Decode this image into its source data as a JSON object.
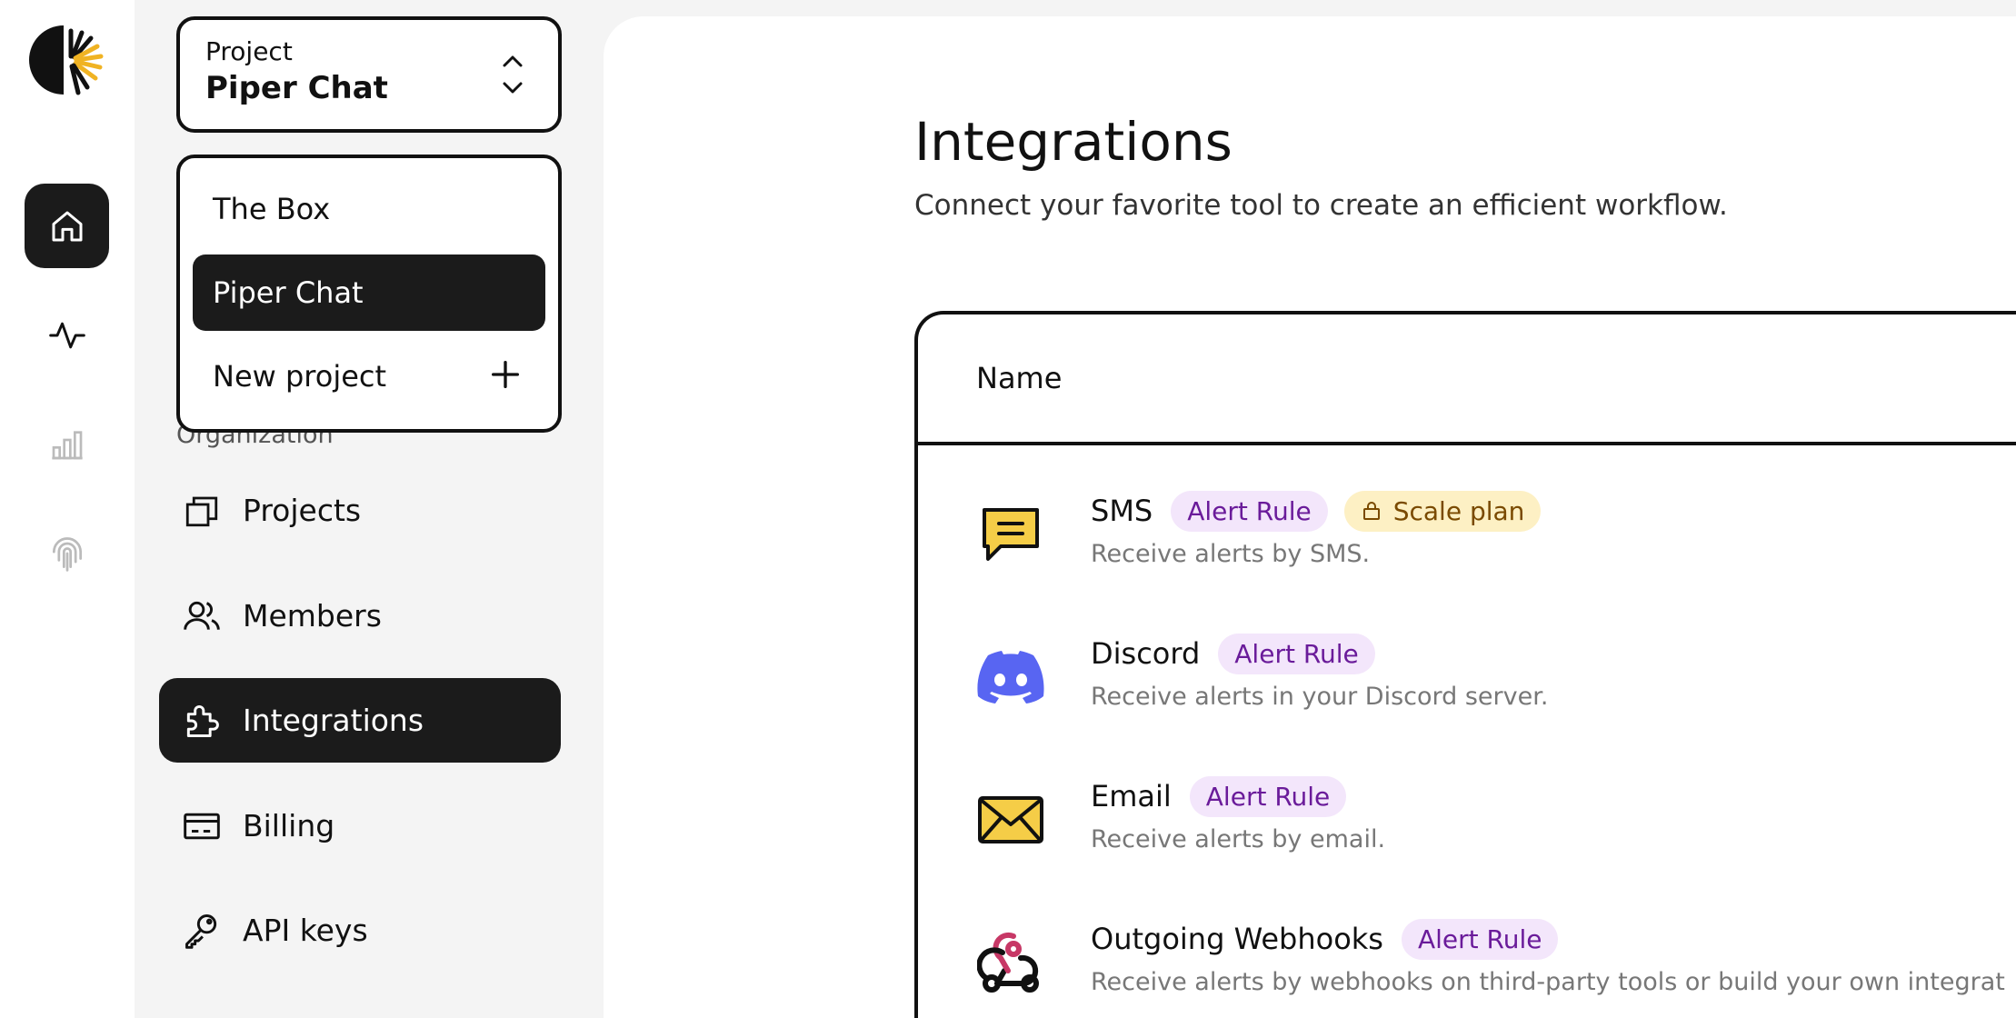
{
  "rail": {
    "icons": [
      "home-icon",
      "activity-icon",
      "bar-chart-icon",
      "fingerprint-icon"
    ]
  },
  "project": {
    "caption": "Project",
    "current": "Piper Chat"
  },
  "dropdown": {
    "items": [
      "The Box",
      "Piper Chat"
    ],
    "new_project": "New project"
  },
  "organization": {
    "label": "Organization",
    "items": [
      {
        "label": "Projects",
        "icon": "projects-icon"
      },
      {
        "label": "Members",
        "icon": "members-icon"
      },
      {
        "label": "Integrations",
        "icon": "puzzle-icon"
      },
      {
        "label": "Billing",
        "icon": "billing-icon"
      },
      {
        "label": "API keys",
        "icon": "key-icon"
      }
    ]
  },
  "main": {
    "title": "Integrations",
    "subtitle": "Connect your favorite tool to create an efficient workflow.",
    "table": {
      "header": "Name",
      "rows": [
        {
          "name": "SMS",
          "badge": "Alert Rule",
          "plan": "Scale plan",
          "desc": "Receive alerts by SMS.",
          "icon": "sms-icon"
        },
        {
          "name": "Discord",
          "badge": "Alert Rule",
          "desc": "Receive alerts in your Discord server.",
          "icon": "discord-icon"
        },
        {
          "name": "Email",
          "badge": "Alert Rule",
          "desc": "Receive alerts by email.",
          "icon": "email-icon"
        },
        {
          "name": "Outgoing Webhooks",
          "badge": "Alert Rule",
          "desc": "Receive alerts by webhooks on third-party tools or build your own integrat",
          "icon": "webhook-icon"
        }
      ]
    }
  },
  "colors": {
    "accent_dark": "#1b1b1b",
    "badge_purple_bg": "#f3e6fb",
    "badge_purple_text": "#6a1b9a",
    "badge_yellow_bg": "#fdf0c4",
    "discord": "#5865F2",
    "sms_yellow": "#f5cd47"
  }
}
